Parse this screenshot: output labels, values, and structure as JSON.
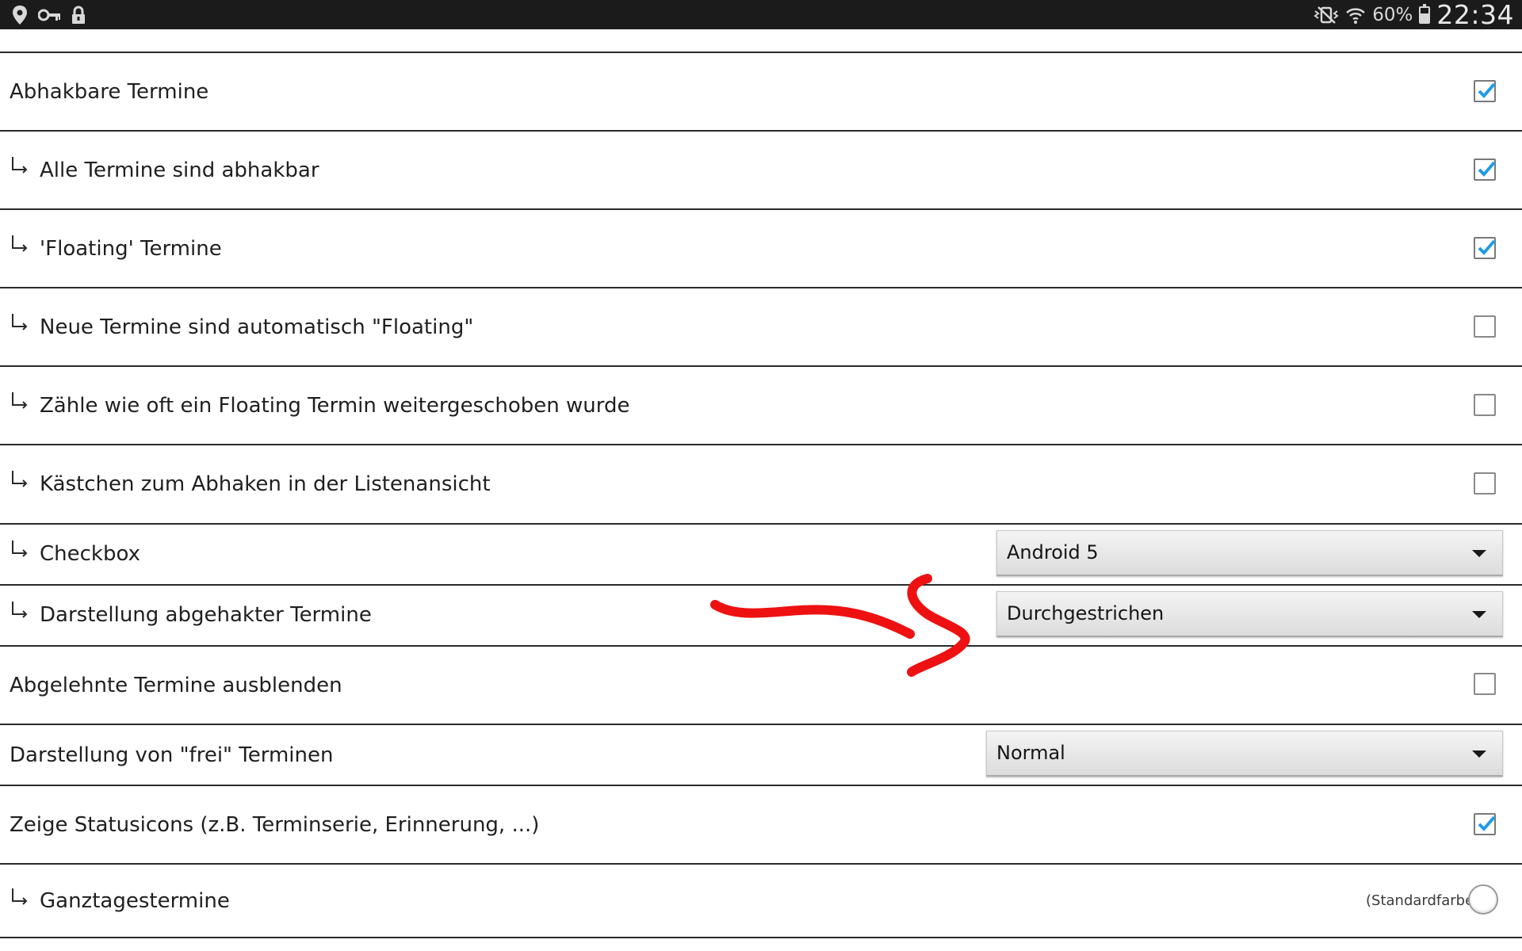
{
  "status_bar": {
    "left_icons": [
      "location-pin-icon",
      "key-icon",
      "lock-icon"
    ],
    "right_icons": [
      "vibrate-mute-icon",
      "wifi-icon"
    ],
    "battery_text": "60%",
    "time": "22:34"
  },
  "settings": [
    {
      "label": "Abhakbare Termine",
      "indent": false,
      "checked": true
    },
    {
      "label": "Alle Termine sind abhakbar",
      "indent": true,
      "checked": true
    },
    {
      "label": "'Floating' Termine",
      "indent": true,
      "checked": true
    },
    {
      "label": "Neue Termine sind automatisch \"Floating\"",
      "indent": true,
      "checked": false
    },
    {
      "label": "Zähle wie oft ein Floating Termin weitergeschoben wurde",
      "indent": true,
      "checked": false
    },
    {
      "label": "Kästchen zum Abhaken in der Listenansicht",
      "indent": true,
      "checked": false
    },
    {
      "label": "Checkbox",
      "indent": true,
      "dropdown_value": "Android 5"
    },
    {
      "label": "Darstellung abgehakter Termine",
      "indent": true,
      "dropdown_value": "Durchgestrichen"
    },
    {
      "label": "Abgelehnte Termine ausblenden",
      "indent": false,
      "checked": false
    },
    {
      "label": "Darstellung von \"frei\" Terminen",
      "indent": false,
      "dropdown_value": "Normal"
    },
    {
      "label": "Zeige Statusicons (z.B. Terminserie, Erinnerung, ...)",
      "indent": false,
      "checked": true
    },
    {
      "label": "Ganztagestermine",
      "indent": true,
      "color_label": "(Standardfarbe)"
    }
  ],
  "colors": {
    "checkmark": "#1e9be8",
    "annotation": "#ee1111",
    "status_bar_bg": "#1b1b1b"
  }
}
